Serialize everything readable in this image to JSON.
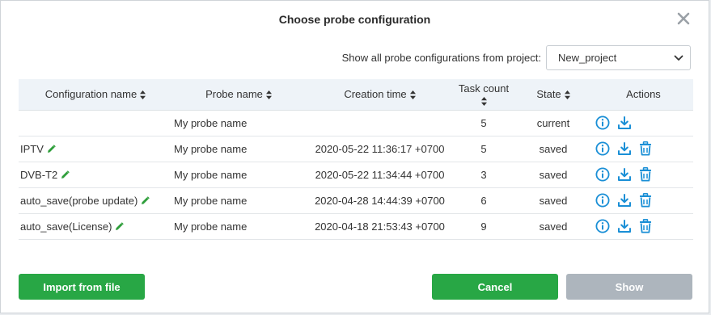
{
  "dialog": {
    "title": "Choose probe configuration",
    "project_label": "Show all probe configurations from project:",
    "project_selected": "New_project"
  },
  "table": {
    "headers": {
      "config_name": "Configuration name",
      "probe_name": "Probe name",
      "creation_time": "Creation time",
      "task_count": "Task count",
      "state": "State",
      "actions": "Actions"
    },
    "rows": [
      {
        "config_name": "",
        "probe_name": "My probe name",
        "creation_time": "",
        "task_count": "5",
        "state": "current",
        "editable": false,
        "deletable": false
      },
      {
        "config_name": "IPTV",
        "probe_name": "My probe name",
        "creation_time": "2020-05-22 11:36:17 +0700",
        "task_count": "5",
        "state": "saved",
        "editable": true,
        "deletable": true
      },
      {
        "config_name": "DVB-T2",
        "probe_name": "My probe name",
        "creation_time": "2020-05-22 11:34:44 +0700",
        "task_count": "3",
        "state": "saved",
        "editable": true,
        "deletable": true
      },
      {
        "config_name": "auto_save(probe update)",
        "probe_name": "My probe name",
        "creation_time": "2020-04-28 14:44:39 +0700",
        "task_count": "6",
        "state": "saved",
        "editable": true,
        "deletable": true
      },
      {
        "config_name": "auto_save(License)",
        "probe_name": "My probe name",
        "creation_time": "2020-04-18 21:53:43 +0700",
        "task_count": "9",
        "state": "saved",
        "editable": true,
        "deletable": true
      }
    ]
  },
  "buttons": {
    "import": "Import from file",
    "cancel": "Cancel",
    "show": "Show"
  },
  "icons": {
    "close": "close-icon",
    "sort": "sort-icon",
    "edit": "pencil-icon",
    "info": "info-icon",
    "download": "download-icon",
    "delete": "trash-icon",
    "select": "chevron-down-icon"
  },
  "colors": {
    "primary_button": "#28a745",
    "disabled_button": "#adb5bd",
    "action_icon": "#1a8fd6",
    "edit_icon": "#2e9e3a",
    "header_bg": "#eef3f8"
  }
}
